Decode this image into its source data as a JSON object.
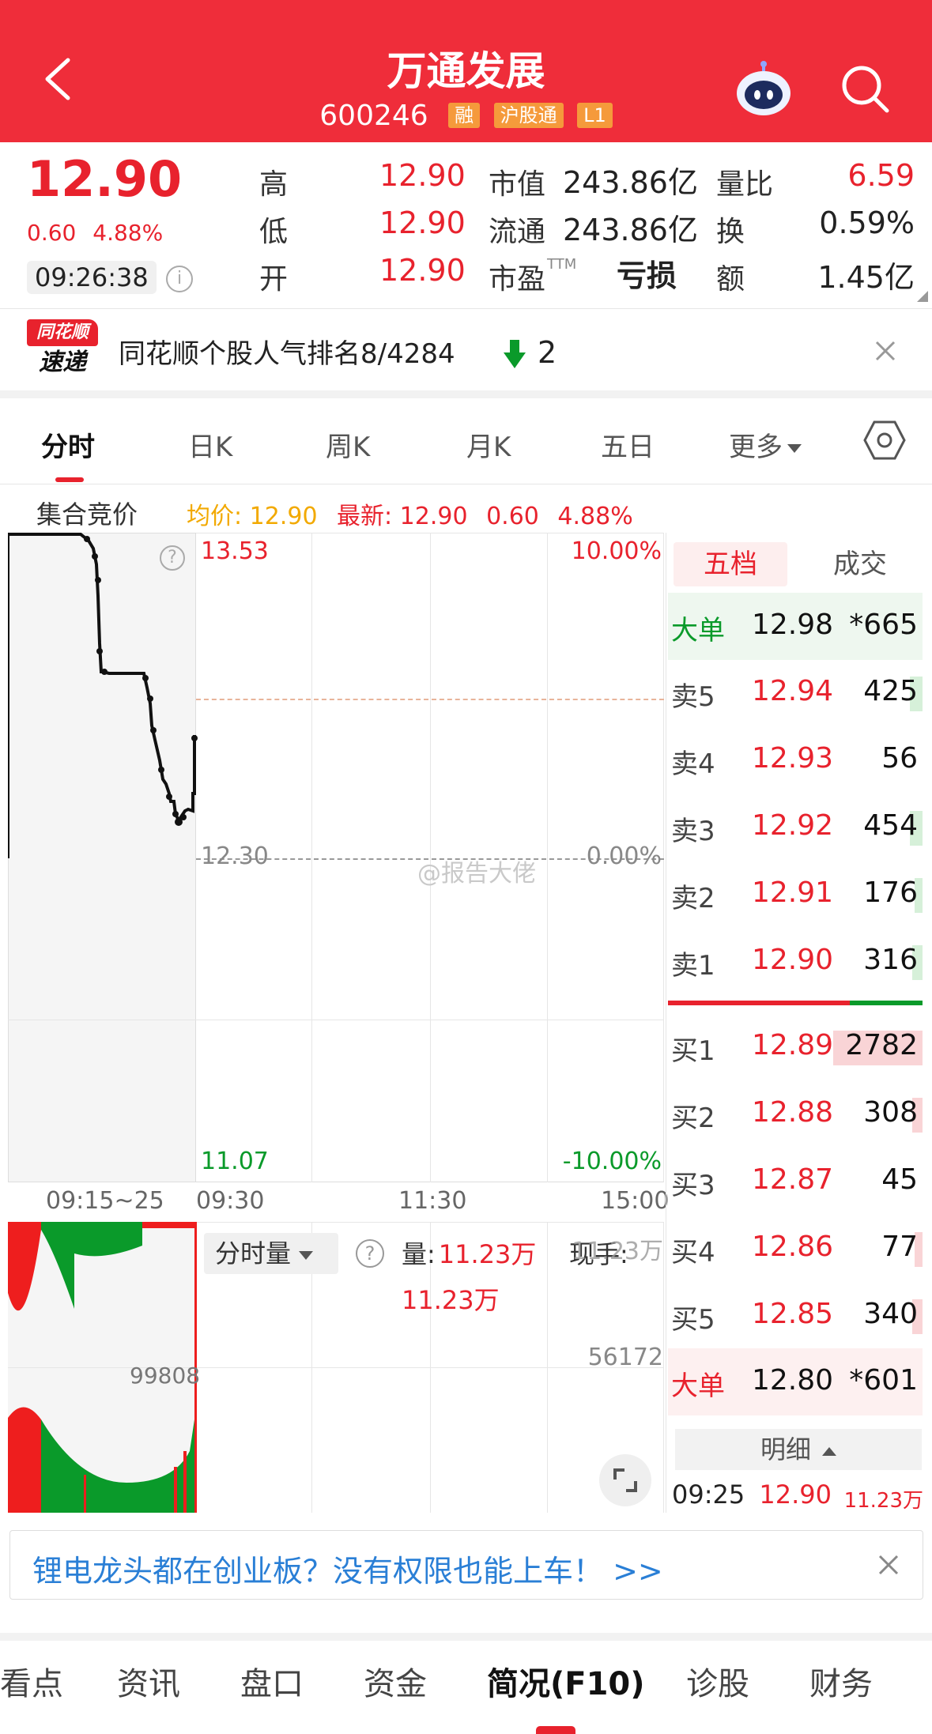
{
  "header": {
    "title": "万通发展",
    "code": "600246",
    "tags": [
      "融",
      "沪股通",
      "L1"
    ]
  },
  "quote": {
    "price": "12.90",
    "change": "0.60",
    "change_pct": "4.88%",
    "time": "09:26:38",
    "high_label": "高",
    "high": "12.90",
    "low_label": "低",
    "low": "12.90",
    "open_label": "开",
    "open": "12.90",
    "mktcap_label": "市值",
    "mktcap": "243.86亿",
    "float_label": "流通",
    "float": "243.86亿",
    "pe_label": "市盈",
    "pe_sup": "TTM",
    "pe": "亏损",
    "volratio_label": "量比",
    "volratio": "6.59",
    "turnover_label": "换",
    "turnover": "0.59%",
    "amount_label": "额",
    "amount": "1.45亿"
  },
  "news": {
    "logo_top": "同花顺",
    "logo_bottom": "速递",
    "text": "同花顺个股人气排名8/4284",
    "rank_change": "2"
  },
  "tabs": [
    "分时",
    "日K",
    "周K",
    "月K",
    "五日",
    "更多"
  ],
  "chart": {
    "auction_label": "集合竞价",
    "avg": "均价: 12.90",
    "latest": "最新: 12.90",
    "latest_change": "0.60",
    "latest_pct": "4.88%",
    "y_top": "13.53",
    "y_mid": "12.30",
    "y_bottom": "11.07",
    "pct_top": "10.00%",
    "pct_mid": "0.00%",
    "pct_bottom": "-10.00%",
    "time_auction": "09:15~25",
    "time_start": "09:30",
    "time_mid": "11:30",
    "time_end": "15:00",
    "watermark": "@报告大佬"
  },
  "volume": {
    "dropdown": "分时量",
    "vol_label": "量:",
    "vol_value": "11.23万",
    "current_label": "现手:",
    "current_value": "11.23万",
    "axis_top": "11.23万",
    "axis_mid": "56172",
    "auction_mark": "99808"
  },
  "orderbook": {
    "tabs": [
      "五档",
      "成交"
    ],
    "big_sell": {
      "label": "大单",
      "price": "12.98",
      "vol": "*665"
    },
    "sells": [
      {
        "label": "卖5",
        "price": "12.94",
        "vol": "425",
        "bar": 0.05
      },
      {
        "label": "卖4",
        "price": "12.93",
        "vol": "56",
        "bar": 0.0
      },
      {
        "label": "卖3",
        "price": "12.92",
        "vol": "454",
        "bar": 0.05
      },
      {
        "label": "卖2",
        "price": "12.91",
        "vol": "176",
        "bar": 0.03
      },
      {
        "label": "卖1",
        "price": "12.90",
        "vol": "316",
        "bar": 0.04
      }
    ],
    "buys": [
      {
        "label": "买1",
        "price": "12.89",
        "vol": "2782",
        "bar": 0.35
      },
      {
        "label": "买2",
        "price": "12.88",
        "vol": "308",
        "bar": 0.04
      },
      {
        "label": "买3",
        "price": "12.87",
        "vol": "45",
        "bar": 0.0
      },
      {
        "label": "买4",
        "price": "12.86",
        "vol": "77",
        "bar": 0.01
      },
      {
        "label": "买5",
        "price": "12.85",
        "vol": "340",
        "bar": 0.04
      }
    ],
    "big_buy": {
      "label": "大单",
      "price": "12.80",
      "vol": "*601"
    },
    "detail_label": "明细",
    "detail": {
      "time": "09:25",
      "price": "12.90",
      "vol": "11.23万"
    }
  },
  "ad": {
    "text": "锂电龙头都在创业板？没有权限也能上车！ >>"
  },
  "bottom_nav": [
    "看点",
    "资讯",
    "盘口",
    "资金",
    "简况(F10)",
    "诊股",
    "财务"
  ],
  "colors": {
    "brand_red": "#ef2d3a",
    "up": "#e8222d",
    "down": "#0a9a2a",
    "avg_line": "#f2a900"
  }
}
